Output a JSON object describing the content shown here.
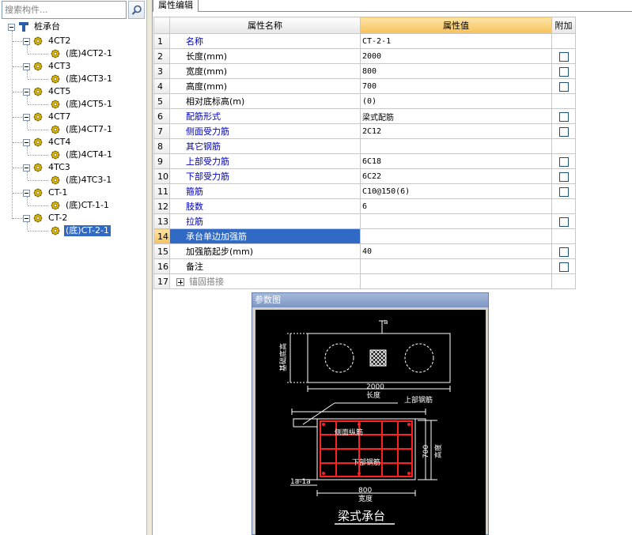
{
  "search": {
    "placeholder": "搜索构件..."
  },
  "tree": {
    "root": "桩承台",
    "nodes": [
      {
        "label": "4CT2",
        "child": "(底)4CT2-1"
      },
      {
        "label": "4CT3",
        "child": "(底)4CT3-1"
      },
      {
        "label": "4CT5",
        "child": "(底)4CT5-1"
      },
      {
        "label": "4CT7",
        "child": "(底)4CT7-1"
      },
      {
        "label": "4CT4",
        "child": "(底)4CT4-1"
      },
      {
        "label": "4TC3",
        "child": "(底)4TC3-1"
      },
      {
        "label": "CT-1",
        "child": "(底)CT-1-1"
      },
      {
        "label": "CT-2",
        "child": "(底)CT-2-1"
      }
    ]
  },
  "tabs": {
    "attr_edit": "属性编辑"
  },
  "grid": {
    "headers": {
      "name": "属性名称",
      "value": "属性值",
      "extra": "附加"
    },
    "rows": [
      {
        "num": "1",
        "name": "名称",
        "value": "CT-2-1"
      },
      {
        "num": "2",
        "name": "长度(mm)",
        "value": "2000"
      },
      {
        "num": "3",
        "name": "宽度(mm)",
        "value": "800"
      },
      {
        "num": "4",
        "name": "高度(mm)",
        "value": "700"
      },
      {
        "num": "5",
        "name": "相对底标高(m)",
        "value": "(0)"
      },
      {
        "num": "6",
        "name": "配筋形式",
        "value": "梁式配筋"
      },
      {
        "num": "7",
        "name": "侧面受力筋",
        "value": "2C12"
      },
      {
        "num": "8",
        "name": "其它钢筋",
        "value": ""
      },
      {
        "num": "9",
        "name": "上部受力筋",
        "value": "6C18"
      },
      {
        "num": "10",
        "name": "下部受力筋",
        "value": "6C22"
      },
      {
        "num": "11",
        "name": "箍筋",
        "value": "C10@150(6)"
      },
      {
        "num": "12",
        "name": "肢数",
        "value": "6"
      },
      {
        "num": "13",
        "name": "拉筋",
        "value": ""
      },
      {
        "num": "14",
        "name": "承台单边加强筋",
        "value": ""
      },
      {
        "num": "15",
        "name": "加强筋起步(mm)",
        "value": "40"
      },
      {
        "num": "16",
        "name": "备注",
        "value": ""
      },
      {
        "num": "17",
        "name": "锚固搭接",
        "value": ""
      }
    ]
  },
  "param": {
    "title": "参数图",
    "labels": {
      "a_mark": "a",
      "side_left": "基础底高",
      "dim_2000": "2000",
      "dim_len": "长度",
      "top_bar": "上部钢筋",
      "side_bar": "侧面纵筋",
      "bottom_bar": "下部钢筋",
      "dim_700": "700",
      "dim_height": "高度",
      "section": "1a-1a",
      "dim_800": "800",
      "dim_width": "宽度",
      "caption": "梁式承台"
    }
  }
}
